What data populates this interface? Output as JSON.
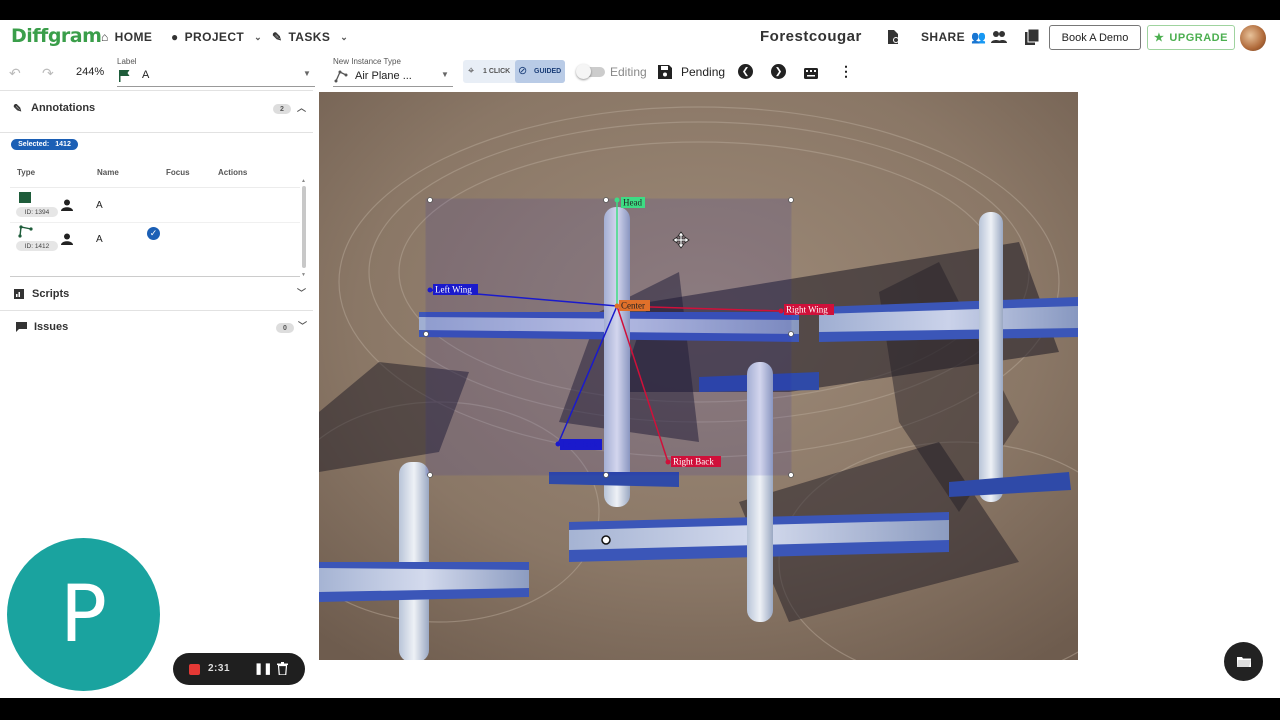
{
  "app": {
    "logo": "Diffgram",
    "project_title": "Forestcougar"
  },
  "nav": {
    "home": "HOME",
    "project": "PROJECT",
    "tasks": "TASKS",
    "share": "SHARE",
    "book_demo": "Book A Demo",
    "upgrade": "UPGRADE"
  },
  "toolbar": {
    "zoom": "244%",
    "label_field_label": "Label",
    "label_value": "A",
    "instance_type_label": "New Instance Type",
    "instance_type_value": "Air Plane ...",
    "one_click": "1 CLICK",
    "guided": "GUIDED",
    "editing_label": "Editing",
    "status": "Pending"
  },
  "annotations": {
    "title": "Annotations",
    "count": "2",
    "selected_label": "Selected:",
    "selected_id": "1412",
    "columns": [
      "Type",
      "Name",
      "Focus",
      "Actions"
    ],
    "rows": [
      {
        "id": "ID: 1394",
        "name": "A",
        "focused": false,
        "type_color": "#1e5c3a"
      },
      {
        "id": "ID: 1412",
        "name": "A",
        "focused": true,
        "type_color": "#1e5c3a"
      }
    ]
  },
  "scripts": {
    "title": "Scripts"
  },
  "issues": {
    "title": "Issues",
    "count": "0"
  },
  "keypoints": {
    "head": "Head",
    "left_wing": "Left Wing",
    "center": "Center",
    "right_wing": "Right Wing",
    "left_back": "Left Back",
    "right_back": "Right Back"
  },
  "recorder": {
    "avatar_letter": "P",
    "time": "2:31"
  },
  "colors": {
    "brand_green": "#3a9e4a",
    "selected_blue": "#1b5fb5",
    "kp_blue": "#1a1acc",
    "kp_red": "#d0103a",
    "kp_orange": "#e0702a",
    "kp_green": "#3ddc84",
    "recorder_teal": "#1aa39f"
  }
}
